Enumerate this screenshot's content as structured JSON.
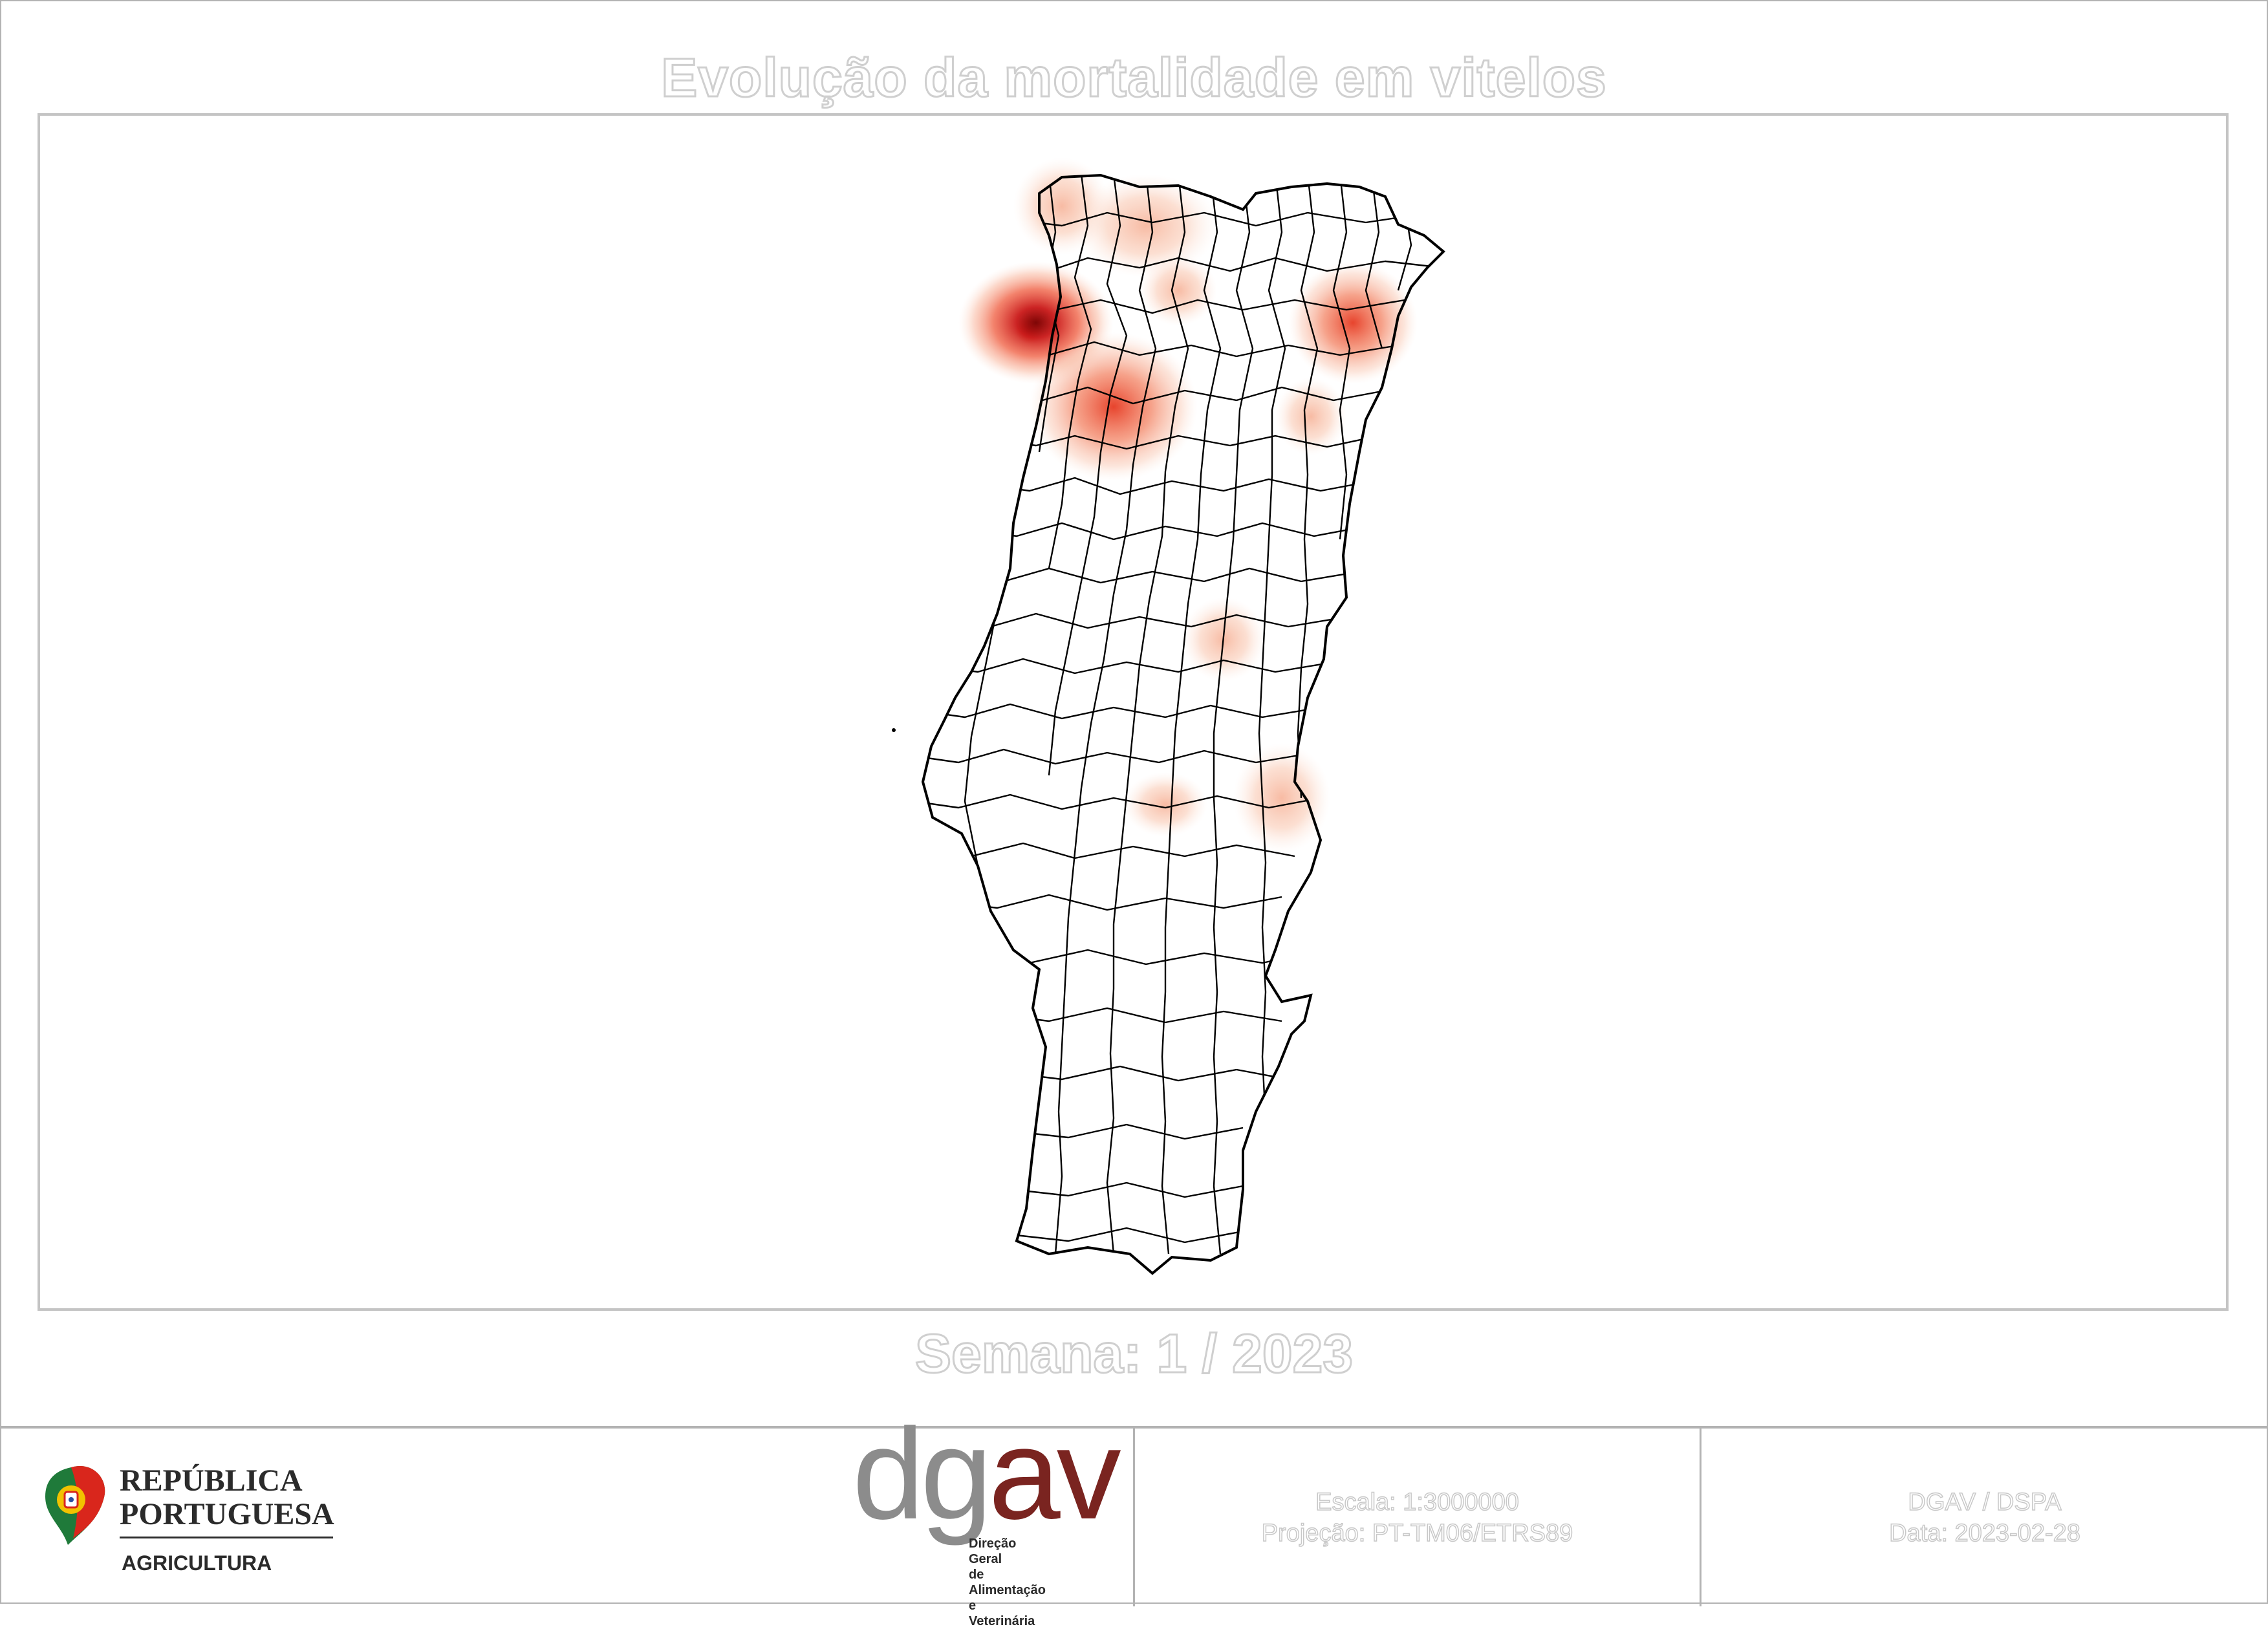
{
  "title": "Evolução da mortalidade em vitelos",
  "week_label": "Semana: 1 / 2023",
  "footer": {
    "gov_name_line1": "REPÚBLICA",
    "gov_name_line2": "PORTUGUESA",
    "gov_department": "AGRICULTURA",
    "agency_acronym_part1": "dg",
    "agency_acronym_part2": "av",
    "agency_name_line1": "Direção Geral",
    "agency_name_line2": "de Alimentação",
    "agency_name_line3": "e Veterinária",
    "scale_text": "Escala: 1:3000000",
    "projection_text": "Projeção: PT-TM06/ETRS89",
    "author_text": "DGAV / DSPA",
    "date_text": "Data: 2023-02-28"
  },
  "map": {
    "type": "heatmap",
    "region": "Portugal continental (concelhos)",
    "heat_colors": [
      "#fde5d8",
      "#f7b49a",
      "#ee6a4a",
      "#d21f1f",
      "#8e0a0a"
    ],
    "hotspots": [
      {
        "area": "Braga / Barcelos",
        "intensity": 1.0
      },
      {
        "area": "Vila Real / Sabrosa",
        "intensity": 0.6
      },
      {
        "area": "Bragança / Vimioso",
        "intensity": 0.55
      },
      {
        "area": "Viana do Castelo / Ponte de Lima",
        "intensity": 0.3
      },
      {
        "area": "Ponte da Barca / Arcos de Valdevez",
        "intensity": 0.25
      },
      {
        "area": "Chaves",
        "intensity": 0.2
      },
      {
        "area": "Mogadouro",
        "intensity": 0.15
      },
      {
        "area": "Guarda / Trancoso",
        "intensity": 0.12
      },
      {
        "area": "Castelo Branco / Idanha-a-Nova",
        "intensity": 0.18
      },
      {
        "area": "Vila de Rei / Sertã",
        "intensity": 0.12
      }
    ]
  }
}
